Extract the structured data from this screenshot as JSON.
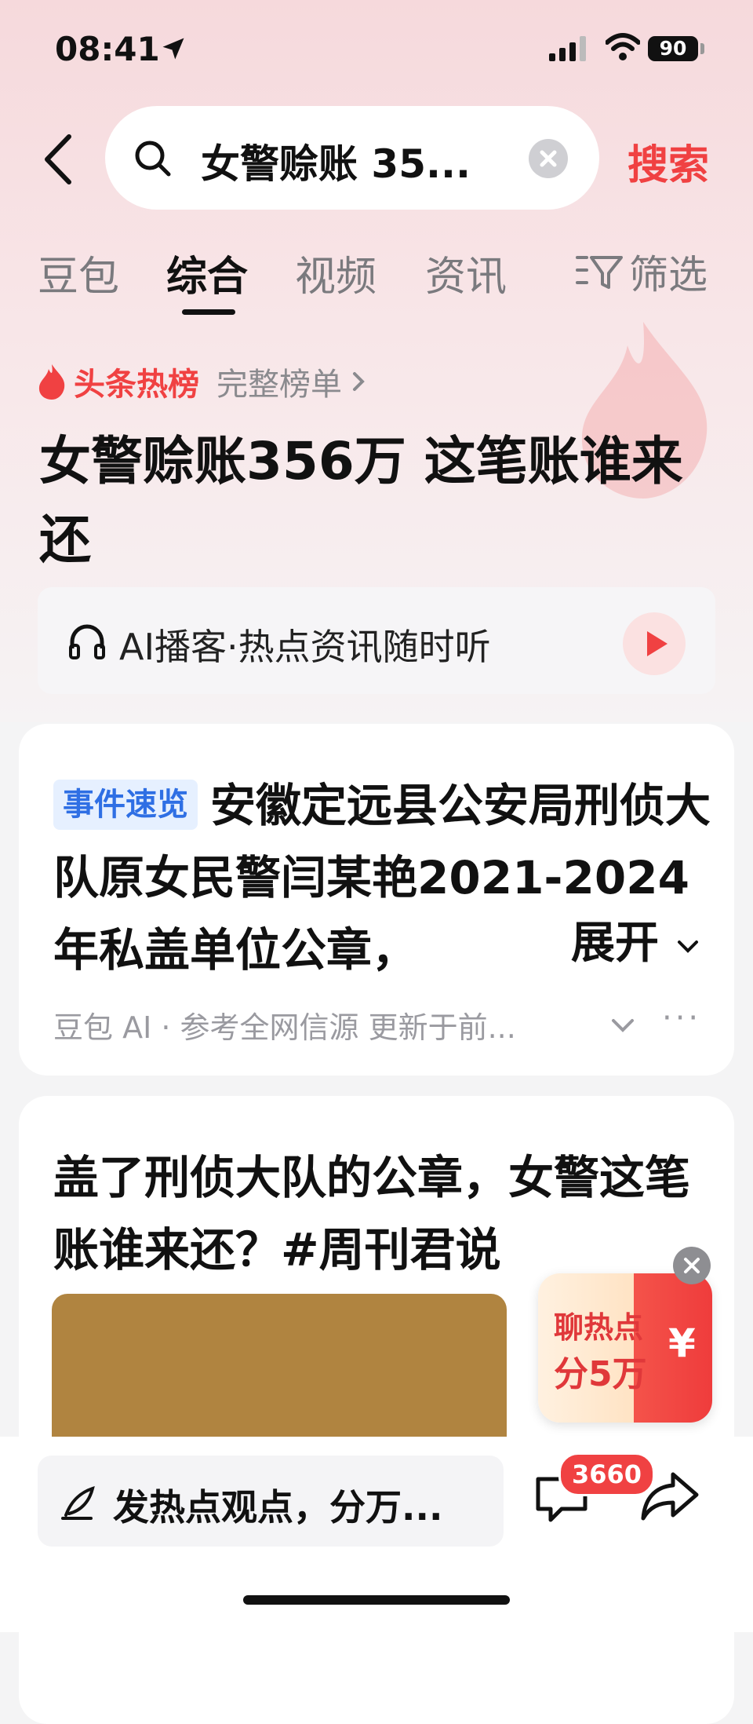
{
  "status_bar": {
    "time": "08:41",
    "battery": "90"
  },
  "search": {
    "query": "女警赊账 35...",
    "submit_label": "搜索"
  },
  "tabs": [
    {
      "label": "豆包"
    },
    {
      "label": "综合"
    },
    {
      "label": "视频"
    },
    {
      "label": "资讯"
    }
  ],
  "filter_label": "筛选",
  "hot_list": {
    "label": "头条热榜",
    "full_list_label": "完整榜单"
  },
  "headline": "女警赊账356万 这笔账谁来还",
  "podcast": {
    "label": "AI播客·热点资讯随时听"
  },
  "summary_card": {
    "tag": "事件速览",
    "text": "安徽定远县公安局刑侦大队原女民警闫某艳2021-2024年私盖单位公章，",
    "expand_label": "展开",
    "meta": "豆包 AI · 参考全网信源 更新于前..."
  },
  "article_card": {
    "title": "盖了刑侦大队的公章，女警这笔账谁来还？#周刊君说"
  },
  "promo": {
    "line1": "聊热点",
    "line2": "分5万",
    "symbol": "¥"
  },
  "bottom_bar": {
    "comment_placeholder": "发热点观点，分万...",
    "comment_count": "3660"
  },
  "colors": {
    "accent": "#f04142",
    "tag_blue": "#2f6fe4"
  }
}
